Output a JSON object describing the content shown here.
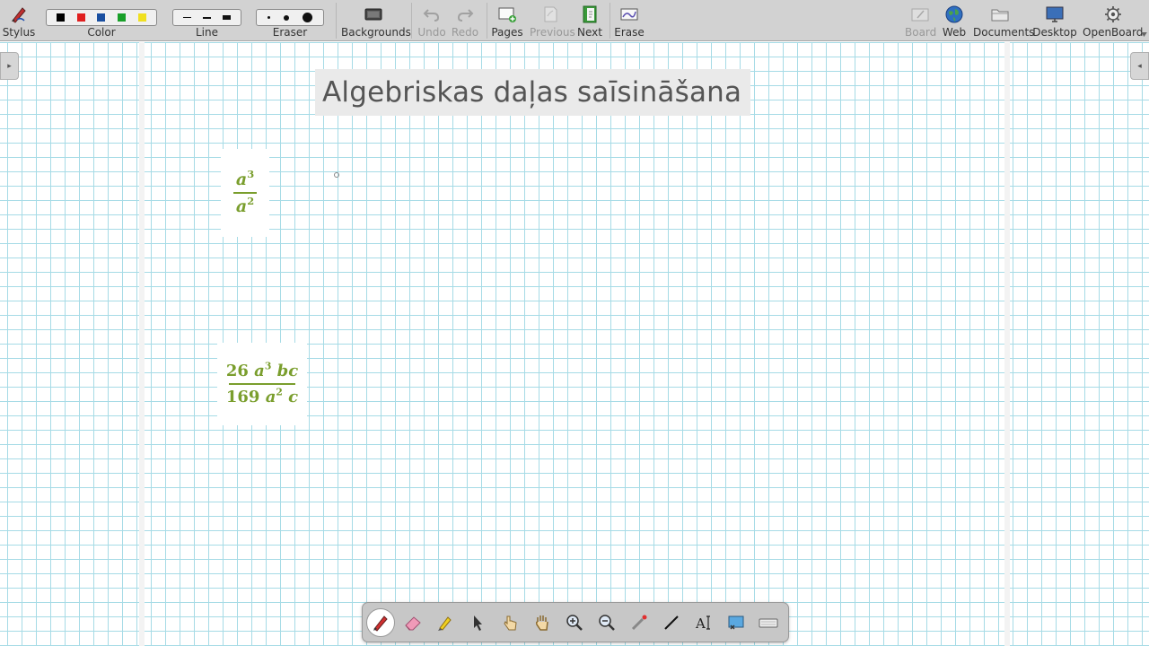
{
  "toolbar": {
    "stylus": "Stylus",
    "color": "Color",
    "line": "Line",
    "eraser": "Eraser",
    "backgrounds": "Backgrounds",
    "undo": "Undo",
    "redo": "Redo",
    "pages": "Pages",
    "previous": "Previous",
    "next": "Next",
    "erase": "Erase",
    "board": "Board",
    "web": "Web",
    "documents": "Documents",
    "desktop": "Desktop",
    "openboard": "OpenBoard"
  },
  "colors": [
    "#000000",
    "#e02020",
    "#1a4fa0",
    "#19a02a",
    "#f0e020"
  ],
  "accent_formula_color": "#7a9e2d",
  "board": {
    "title": "Algebriskas daļas saīsināšana",
    "formula1": {
      "num_base": "a",
      "num_exp": "3",
      "den_base": "a",
      "den_exp": "2"
    },
    "formula2": {
      "num_coef": "26",
      "num_var": "a",
      "num_exp": "3",
      "num_rest": "bc",
      "den_coef": "169",
      "den_var": "a",
      "den_exp": "2",
      "den_rest": "c"
    }
  },
  "palette_tools": [
    "pen-icon",
    "eraser-icon",
    "highlighter-icon",
    "select-icon",
    "interact-icon",
    "hand-icon",
    "zoom-in-icon",
    "zoom-out-icon",
    "laser-icon",
    "line-icon",
    "text-icon",
    "capture-icon",
    "keyboard-icon"
  ]
}
